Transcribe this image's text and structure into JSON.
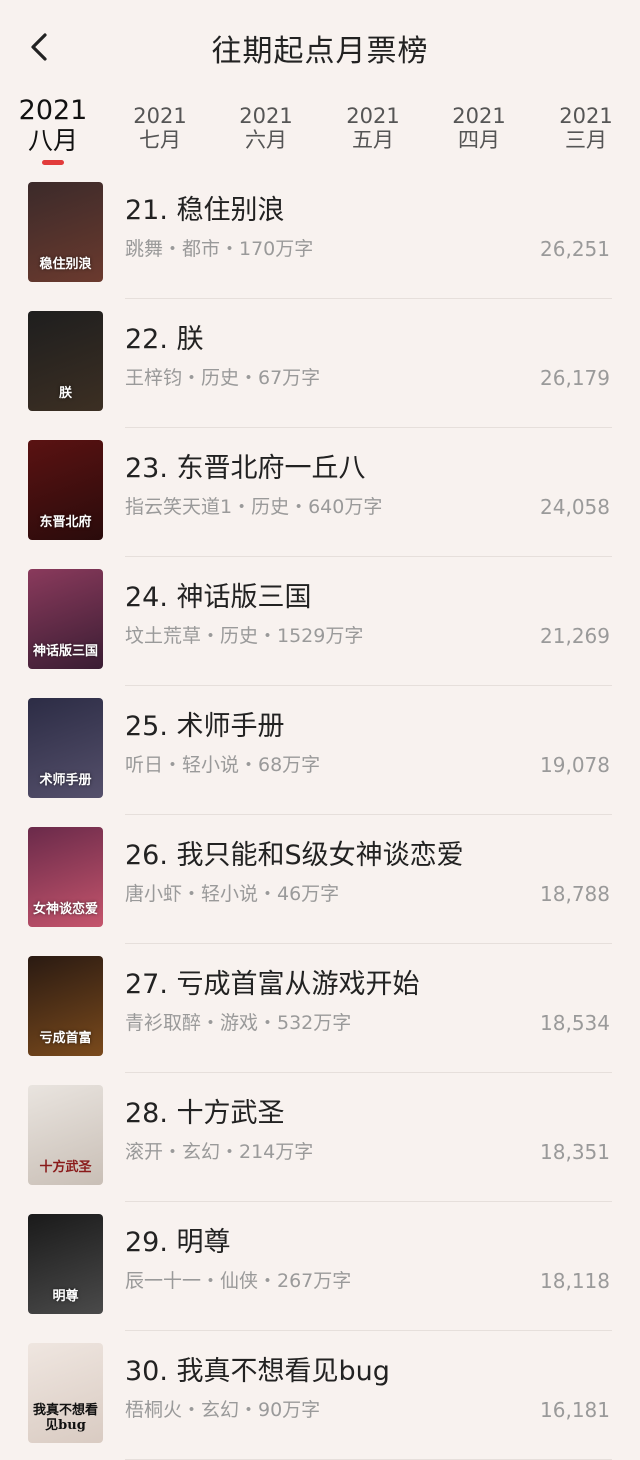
{
  "header": {
    "title": "往期起点月票榜",
    "back_icon": "chevron-left-icon"
  },
  "tabs": [
    {
      "year": "2021",
      "month": "八月",
      "active": true
    },
    {
      "year": "2021",
      "month": "七月",
      "active": false
    },
    {
      "year": "2021",
      "month": "六月",
      "active": false
    },
    {
      "year": "2021",
      "month": "五月",
      "active": false
    },
    {
      "year": "2021",
      "month": "四月",
      "active": false
    },
    {
      "year": "2021",
      "month": "三月",
      "active": false
    }
  ],
  "books": [
    {
      "title": "21. 稳住别浪",
      "meta": "跳舞・都市・170万字",
      "votes": "26,251",
      "cover_text": "稳住别浪",
      "cover_colors": [
        "#3b2a2a",
        "#6b3a2e"
      ]
    },
    {
      "title": "22. 朕",
      "meta": "王梓钧・历史・67万字",
      "votes": "26,179",
      "cover_text": "朕",
      "cover_colors": [
        "#1e1e1e",
        "#3c2f23"
      ]
    },
    {
      "title": "23. 东晋北府一丘八",
      "meta": "指云笑天道1・历史・640万字",
      "votes": "24,058",
      "cover_text": "东晋北府",
      "cover_colors": [
        "#5a1212",
        "#2a0b0b"
      ]
    },
    {
      "title": "24. 神话版三国",
      "meta": "坟土荒草・历史・1529万字",
      "votes": "21,269",
      "cover_text": "神话版三国",
      "cover_colors": [
        "#8a3a5c",
        "#3a1d33"
      ]
    },
    {
      "title": "25. 术师手册",
      "meta": "听日・轻小说・68万字",
      "votes": "19,078",
      "cover_text": "术师手册",
      "cover_colors": [
        "#2c2c45",
        "#55506b"
      ]
    },
    {
      "title": "26. 我只能和S级女神谈恋爱",
      "meta": "唐小虾・轻小说・46万字",
      "votes": "18,788",
      "cover_text": "女神谈恋爱",
      "cover_colors": [
        "#6a2a4a",
        "#c5556c"
      ]
    },
    {
      "title": "27. 亏成首富从游戏开始",
      "meta": "青衫取醉・游戏・532万字",
      "votes": "18,534",
      "cover_text": "亏成首富",
      "cover_colors": [
        "#2a1a12",
        "#7a4a1c"
      ]
    },
    {
      "title": "28. 十方武圣",
      "meta": "滚开・玄幻・214万字",
      "votes": "18,351",
      "cover_text": "十方武圣",
      "cover_colors": [
        "#e9e4df",
        "#c9bfb6"
      ]
    },
    {
      "title": "29. 明尊",
      "meta": "辰一十一・仙侠・267万字",
      "votes": "18,118",
      "cover_text": "明尊",
      "cover_colors": [
        "#1a1a1a",
        "#4a4a4a"
      ]
    },
    {
      "title": "30. 我真不想看见bug",
      "meta": "梧桐火・玄幻・90万字",
      "votes": "16,181",
      "cover_text": "我真不想看见bug",
      "cover_colors": [
        "#efe6e0",
        "#d9cbc2"
      ]
    }
  ]
}
